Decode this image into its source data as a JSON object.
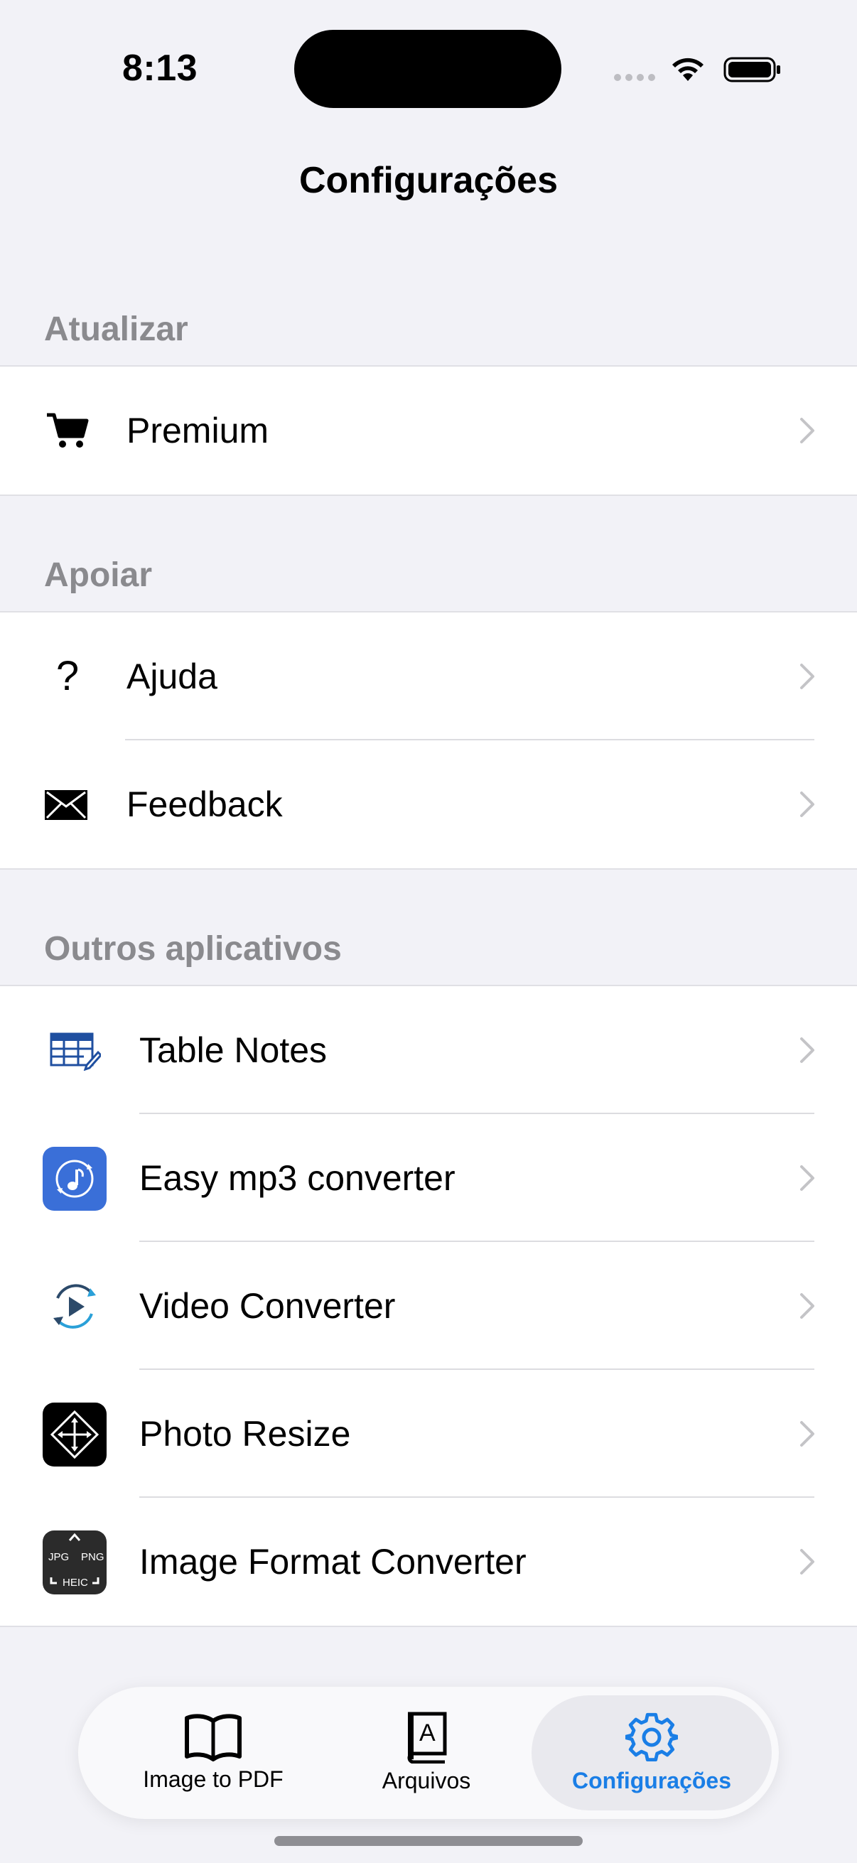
{
  "status_bar": {
    "time": "8:13"
  },
  "nav": {
    "title": "Configurações"
  },
  "sections": [
    {
      "header": "Atualizar",
      "rows": [
        {
          "label": "Premium",
          "icon": "cart-icon"
        }
      ]
    },
    {
      "header": "Apoiar",
      "rows": [
        {
          "label": "Ajuda",
          "icon": "question-icon"
        },
        {
          "label": "Feedback",
          "icon": "envelope-icon"
        }
      ]
    },
    {
      "header": "Outros aplicativos",
      "rows": [
        {
          "label": "Table Notes",
          "icon": "table-notes-app-icon"
        },
        {
          "label": "Easy mp3 converter",
          "icon": "mp3-converter-app-icon"
        },
        {
          "label": "Video Converter",
          "icon": "video-converter-app-icon"
        },
        {
          "label": "Photo Resize",
          "icon": "photo-resize-app-icon"
        },
        {
          "label": "Image Format Converter",
          "icon": "image-format-converter-app-icon"
        }
      ]
    }
  ],
  "image_format_icon": {
    "jpg": "JPG",
    "png": "PNG",
    "heic": "HEIC"
  },
  "arquivos_icon_letter": "A",
  "tabbar": {
    "tabs": [
      {
        "label": "Image to PDF",
        "icon": "book-icon",
        "active": false
      },
      {
        "label": "Arquivos",
        "icon": "dictionary-icon",
        "active": false
      },
      {
        "label": "Configurações",
        "icon": "gear-icon",
        "active": true
      }
    ]
  },
  "colors": {
    "accent": "#1a7ee6",
    "background": "#f2f2f7",
    "section_header": "#8a8a8e",
    "chevron": "#c4c4c7"
  }
}
